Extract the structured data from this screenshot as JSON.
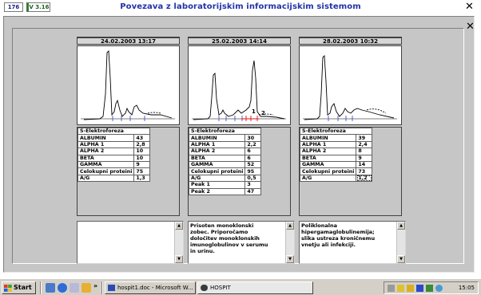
{
  "window": {
    "id_badge": "176",
    "version_badge": "V 3.16",
    "title": "Povezava z laboratorijskim informacijskim sistemom",
    "close_glyph": "✕"
  },
  "samples": [
    {
      "date": "24.02.2003 13:17",
      "table_title": "S-Elektroforeza",
      "rows": [
        {
          "label": "ALBUMIN",
          "value": "43"
        },
        {
          "label": "ALPHA 1",
          "value": "2,8"
        },
        {
          "label": "ALPHA 2",
          "value": "10"
        },
        {
          "label": "BETA",
          "value": "10"
        },
        {
          "label": "GAMMA",
          "value": "9"
        },
        {
          "label": "Celokupni proteini",
          "value": "75"
        },
        {
          "label": "A/G",
          "value": "1,3"
        }
      ],
      "comment": ""
    },
    {
      "date": "25.02.2003 14:14",
      "peak_labels": [
        "1",
        "2"
      ],
      "table_title": "S-Elektroforeza",
      "rows": [
        {
          "label": "ALBUMIN",
          "value": "30"
        },
        {
          "label": "ALPHA 1",
          "value": "2,2"
        },
        {
          "label": "ALPHA 2",
          "value": "6"
        },
        {
          "label": "BETA",
          "value": "6"
        },
        {
          "label": "GAMMA",
          "value": "52"
        },
        {
          "label": "Celokupni proteini",
          "value": "95"
        },
        {
          "label": "A/G",
          "value": "0,5"
        },
        {
          "label": "Peak 1",
          "value": "3"
        },
        {
          "label": "Peak 2",
          "value": "47"
        }
      ],
      "comment": "Prisoten monoklonski\nzobec. Priporočamo\ndoločitev  monoklonskih\nimunoglobulinov v serumu\nin urinu."
    },
    {
      "date": "28.02.2003 10:32",
      "table_title": "S-Elektroforeza",
      "rows": [
        {
          "label": "ALBUMIN",
          "value": "39"
        },
        {
          "label": "ALPHA 1",
          "value": "2,4"
        },
        {
          "label": "ALPHA 2",
          "value": "8"
        },
        {
          "label": "BETA",
          "value": "9"
        },
        {
          "label": "GAMMA",
          "value": "14"
        },
        {
          "label": "Celokupni proteini",
          "value": "73"
        },
        {
          "label": "A/G",
          "value": "1,2"
        }
      ],
      "comment": "Poliklonalna\nhipergamaglobulinemija;\nslika ustreza kroničnemu\nvnetju ali infekciji."
    }
  ],
  "taskbar": {
    "start_label": "Start",
    "chevron": "»",
    "tasks": [
      {
        "label": "hospit1.doc - Microsoft W..."
      },
      {
        "label": "HOSPIT"
      }
    ],
    "clock": "15:05"
  }
}
